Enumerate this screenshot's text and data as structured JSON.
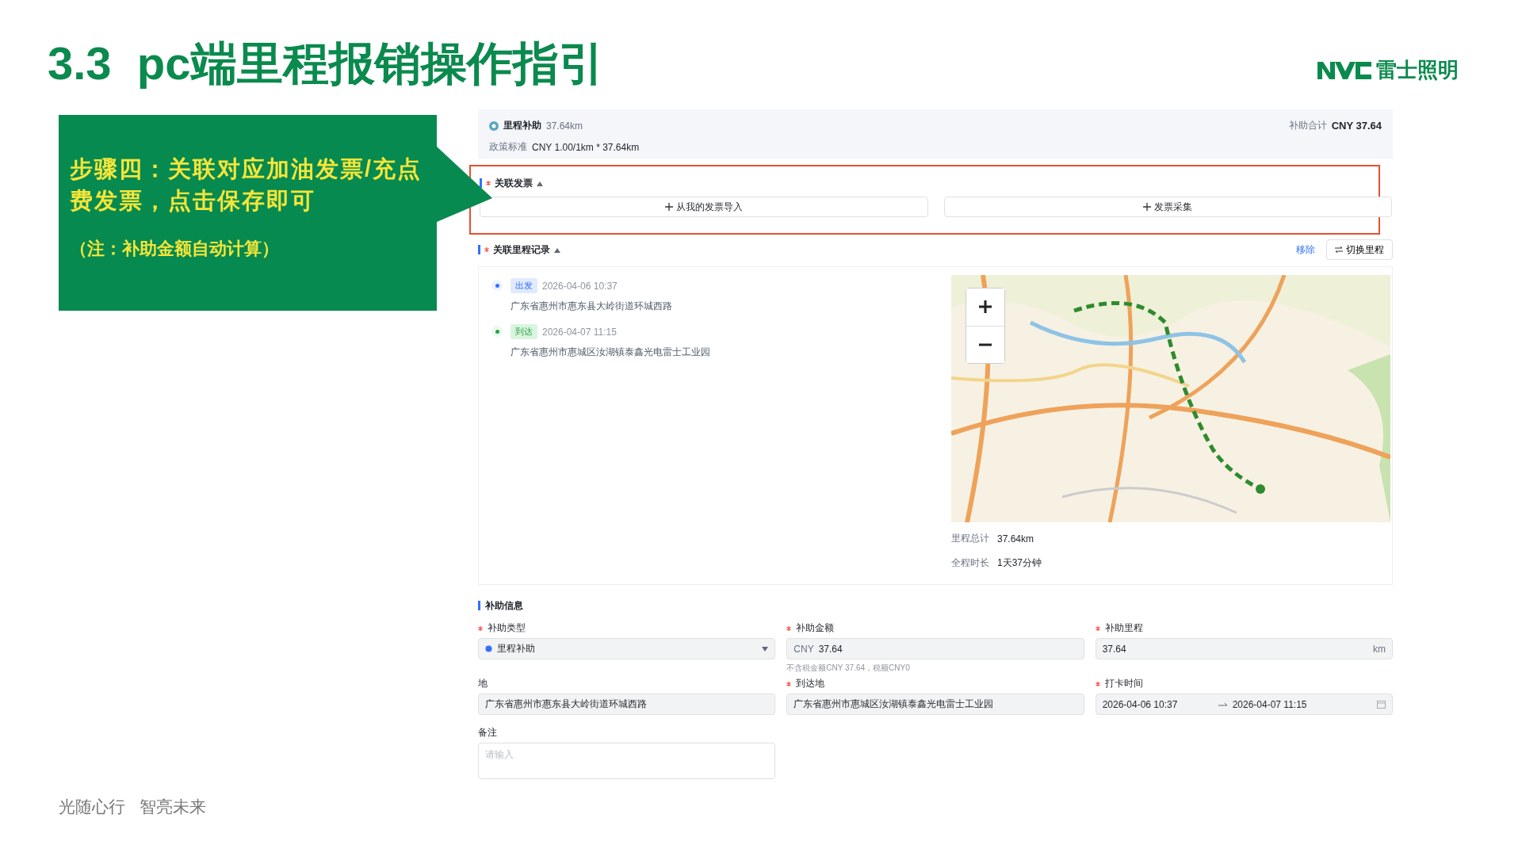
{
  "slide": {
    "title": "3.3  pc端里程报销操作指引",
    "brand": "雷士照明",
    "callout": {
      "step": "步骤四：关联对应加油发票/充点费发票，点击保存即可",
      "note": "（注：补助金额自动计算）"
    },
    "footer": [
      "光随心行",
      "智亮未来"
    ]
  },
  "summary": {
    "name": "里程补助",
    "distance": "37.64km",
    "policy_label": "政策标准",
    "policy": "CNY 1.00/1km * 37.64km",
    "total_label": "补助合计",
    "total": "CNY 37.64"
  },
  "invoice_section": {
    "title": "关联发票",
    "required": true,
    "expanded": true,
    "highlighted": true,
    "buttons": [
      "从我的发票导入",
      "发票采集"
    ]
  },
  "trip_section": {
    "title": "关联里程记录",
    "required": true,
    "expanded": true,
    "actions": [
      {
        "kind": "link",
        "label": "移除"
      },
      {
        "kind": "button",
        "label": "切换里程"
      }
    ],
    "stops": [
      {
        "kind": "depart",
        "tag": "出发",
        "time": "2026-04-06 10:37",
        "address": "广东省惠州市惠东县大岭街道环城西路"
      },
      {
        "kind": "arrive",
        "tag": "到达",
        "time": "2026-04-07 11:15",
        "address": "广东省惠州市惠城区汝湖镇泰鑫光电雷士工业园"
      }
    ],
    "stats": [
      {
        "label": "里程总计",
        "value": "37.64km"
      },
      {
        "label": "全程时长",
        "value": "1天37分钟"
      }
    ]
  },
  "subsidy": {
    "title": "补助信息",
    "fields": [
      {
        "kind": "select",
        "label": "补助类型",
        "required": true,
        "value": "里程补助"
      },
      {
        "kind": "money",
        "label": "补助金额",
        "required": true,
        "prefix": "CNY",
        "value": "37.64",
        "hint": "不含税金额CNY 37.64，税额CNY0"
      },
      {
        "kind": "unit",
        "label": "补助里程",
        "required": true,
        "value": "37.64",
        "unit": "km"
      },
      {
        "kind": "text",
        "label": "地",
        "required": false,
        "value": "广东省惠州市惠东县大岭街道环城西路"
      },
      {
        "kind": "text",
        "label": "到达地",
        "required": true,
        "value": "广东省惠州市惠城区汝湖镇泰鑫光电雷士工业园"
      },
      {
        "kind": "range",
        "label": "打卡时间",
        "required": true,
        "start": "2026-04-06 10:37",
        "end": "2026-04-07 11:15"
      },
      {
        "kind": "textarea",
        "label": "备注",
        "required": false,
        "placeholder": "请输入"
      }
    ]
  }
}
